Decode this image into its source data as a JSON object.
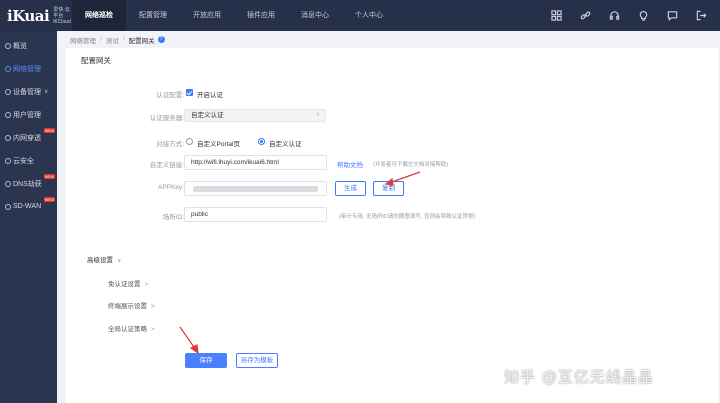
{
  "brand": {
    "logo": "iKuai",
    "sub1": "爱快·云平台",
    "sub2": "iKCloud"
  },
  "topnav": [
    "网络巡检",
    "配置管理",
    "开放应用",
    "插件应用",
    "消息中心",
    "个人中心"
  ],
  "top_icons": [
    "grid-icon",
    "link-icon",
    "headset-icon",
    "bulb-icon",
    "message-icon",
    "logout-icon"
  ],
  "sidebar": [
    {
      "label": "概览",
      "badge": ""
    },
    {
      "label": "网络管理",
      "badge": ""
    },
    {
      "label": "设备管理",
      "badge": ""
    },
    {
      "label": "用户管理",
      "badge": ""
    },
    {
      "label": "内网穿透",
      "badge": "NEW"
    },
    {
      "label": "云安全",
      "badge": ""
    },
    {
      "label": "DNS劫获",
      "badge": "NEW"
    },
    {
      "label": "SD-WAN",
      "badge": "NEW"
    }
  ],
  "breadcrumb": [
    "网络管理",
    "测试",
    "配置网关"
  ],
  "panel": {
    "title": "配置网关",
    "auth_config_label": "认证配置:",
    "auth_enable_text": "开启认证",
    "auth_server_label": "认证服务器:",
    "auth_server_value": "自定义认证",
    "dock_mode_label": "对接方式:",
    "radio_portal": "自定义Portal页",
    "radio_custom": "自定义认证",
    "link_label": "自定义链接:",
    "link_value": "http://wifi.ihuyi.com/ikuai6.html",
    "help_doc": "帮助文档",
    "link_hint": "(开发者可下载左文档对接帮助)",
    "appkey_label": "APPKey:",
    "generate_btn": "生成",
    "copy_btn": "复制",
    "site_label": "场所ID:",
    "site_value": "public",
    "site_hint": "(审计专用, 无场所ID请勿随意填写, 否则会导致认证异常)",
    "advanced": "高级设置",
    "sub_items": [
      "免认证设置",
      "终端展示设置",
      "全局认证策略"
    ],
    "save_btn": "保存",
    "save_template_btn": "另存为模板"
  },
  "watermark": "知乎 @互亿无线晶晶",
  "colors": {
    "topbar": "#27304a",
    "sidebar": "#2c3550",
    "accent": "#3b7cff",
    "arrow": "#e03a3a"
  }
}
